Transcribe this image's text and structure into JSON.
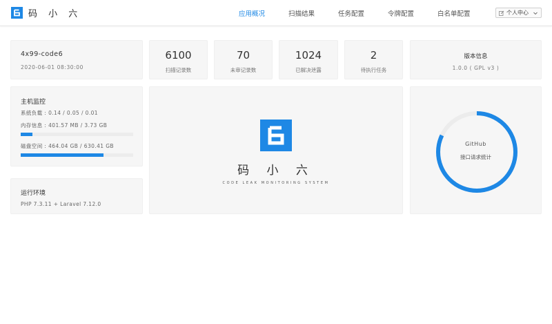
{
  "app": {
    "logo_glyph": "6",
    "name": "码 小 六"
  },
  "nav": {
    "items": [
      "应用概况",
      "扫描结果",
      "任务配置",
      "令牌配置",
      "白名单配置"
    ],
    "active_index": 0,
    "user_menu": "个人中心"
  },
  "info": {
    "instance": "4x99-code6",
    "datetime": "2020-06-01 08:30:00"
  },
  "stats": [
    {
      "value": "6100",
      "label": "扫描记录数"
    },
    {
      "value": "70",
      "label": "未审记录数"
    },
    {
      "value": "1024",
      "label": "已解决泄露"
    },
    {
      "value": "2",
      "label": "待执行任务"
    }
  ],
  "version": {
    "title": "版本信息",
    "value": "1.0.0 ( GPL v3 )"
  },
  "monitor": {
    "title": "主机监控",
    "load": "系统负载 : 0.14 / 0.05 / 0.01",
    "memory": "内存信息 : 401.57 MB / 3.73 GB",
    "memory_fraction": 0.105,
    "disk": "磁盘空间 : 464.04 GB / 630.41 GB",
    "disk_fraction": 0.736
  },
  "env": {
    "title": "运行环境",
    "value": "PHP 7.3.11 + Laravel 7.12.0"
  },
  "brand": {
    "name": "码 小 六",
    "tagline": "CODE LEAK MONITORING SYSTEM"
  },
  "ring": {
    "title": "GitHub",
    "subtitle": "接口请求统计",
    "fraction": 0.82,
    "color": "#1e88e5",
    "track_color": "#ececec"
  },
  "colors": {
    "accent": "#1e88e5"
  }
}
